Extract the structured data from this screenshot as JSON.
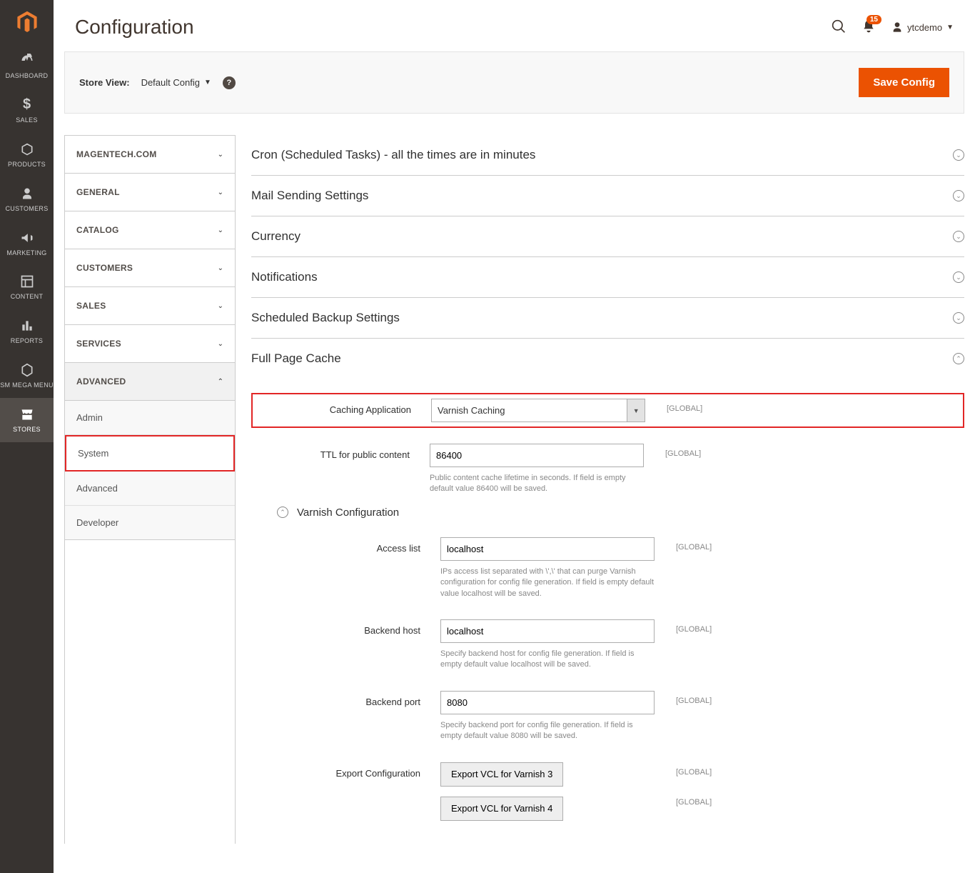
{
  "page": {
    "title": "Configuration",
    "notification_count": "15",
    "user": "ytcdemo"
  },
  "scope": {
    "label": "Store View:",
    "value": "Default Config",
    "save_btn": "Save Config"
  },
  "nav": [
    {
      "id": "dashboard",
      "label": "DASHBOARD"
    },
    {
      "id": "sales",
      "label": "SALES"
    },
    {
      "id": "products",
      "label": "PRODUCTS"
    },
    {
      "id": "customers",
      "label": "CUSTOMERS"
    },
    {
      "id": "marketing",
      "label": "MARKETING"
    },
    {
      "id": "content",
      "label": "CONTENT"
    },
    {
      "id": "reports",
      "label": "REPORTS"
    },
    {
      "id": "megamenu",
      "label": "SM MEGA MENU"
    },
    {
      "id": "stores",
      "label": "STORES"
    }
  ],
  "tabs": [
    {
      "label": "MAGENTECH.COM",
      "expanded": false
    },
    {
      "label": "GENERAL",
      "expanded": false
    },
    {
      "label": "CATALOG",
      "expanded": false
    },
    {
      "label": "CUSTOMERS",
      "expanded": false
    },
    {
      "label": "SALES",
      "expanded": false
    },
    {
      "label": "SERVICES",
      "expanded": false
    },
    {
      "label": "ADVANCED",
      "expanded": true,
      "children": [
        {
          "label": "Admin",
          "active": false
        },
        {
          "label": "System",
          "active": true
        },
        {
          "label": "Advanced",
          "active": false
        },
        {
          "label": "Developer",
          "active": false
        }
      ]
    }
  ],
  "sections": {
    "cron": "Cron (Scheduled Tasks) - all the times are in minutes",
    "mail": "Mail Sending Settings",
    "currency": "Currency",
    "notif": "Notifications",
    "backup": "Scheduled Backup Settings",
    "fpc": "Full Page Cache"
  },
  "fpc": {
    "caching_app_label": "Caching Application",
    "caching_app_value": "Varnish Caching",
    "ttl_label": "TTL for public content",
    "ttl_value": "86400",
    "ttl_hint": "Public content cache lifetime in seconds. If field is empty default value 86400 will be saved.",
    "scope": "[GLOBAL]",
    "varnish_title": "Varnish Configuration",
    "access_list_label": "Access list",
    "access_list_value": "localhost",
    "access_list_hint": "IPs access list separated with \\',\\' that can purge Varnish configuration for config file generation. If field is empty default value localhost will be saved.",
    "backend_host_label": "Backend host",
    "backend_host_value": "localhost",
    "backend_host_hint": "Specify backend host for config file generation. If field is empty default value localhost will be saved.",
    "backend_port_label": "Backend port",
    "backend_port_value": "8080",
    "backend_port_hint": "Specify backend port for config file generation. If field is empty default value 8080 will be saved.",
    "export_label": "Export Configuration",
    "export_v3": "Export VCL for Varnish 3",
    "export_v4": "Export VCL for Varnish 4"
  }
}
